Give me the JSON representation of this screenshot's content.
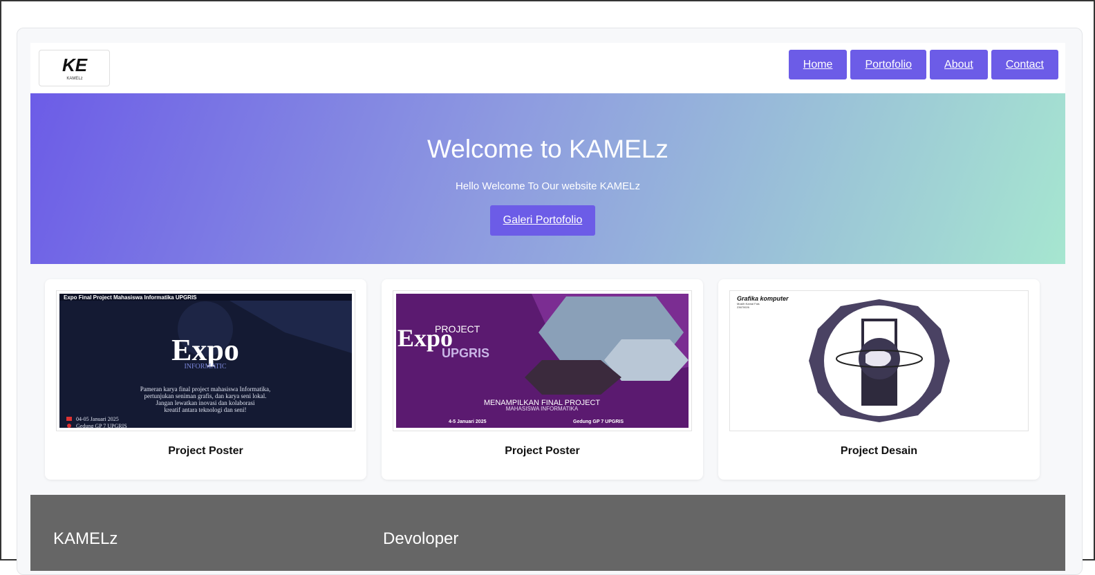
{
  "brand": {
    "logo_text": "KE",
    "logo_subtext": "KAMELz"
  },
  "nav": [
    {
      "label": "Home"
    },
    {
      "label": "Portofolio"
    },
    {
      "label": "About"
    },
    {
      "label": "Contact"
    }
  ],
  "hero": {
    "title": "Welcome to KAMELz",
    "subtitle": "Hello Welcome To Our website KAMELz",
    "button_label": "Galeri Portofolio"
  },
  "cards": [
    {
      "title": "Project Poster",
      "poster": {
        "header": "Expo Final Project Mahasiswa Informatika UPGRIS",
        "big": "Expo",
        "sub": "INFORMATIC",
        "desc1": "Pameran karya final project mahasiswa Informatika,",
        "desc2": "pertunjukan seniman grafis, dan karya seni lokal.",
        "desc3": "Jangan lewatkan inovasi dan kolaborasi",
        "desc4": "kreatif antara teknologi dan seni!",
        "date": "04-05 Januari 2025",
        "place": "Gedung GP 7 UPGRIS"
      }
    },
    {
      "title": "Project Poster",
      "poster": {
        "small": "PROJECT",
        "big": "Expo",
        "sub": "UPGRIS",
        "line1": "MENAMPILKAN FINAL PROJECT",
        "line2": "MAHASISWA INFORMATIKA",
        "date": "4-5 Januari 2025",
        "place": "Gedung GP 7 UPGRIS"
      }
    },
    {
      "title": "Project Desain",
      "poster": {
        "heading": "Grafika komputer",
        "name": "Muslih Kamal Fais",
        "id": "23670026"
      }
    }
  ],
  "footer": {
    "col1_title": "KAMELz",
    "col2_title": "Devoloper"
  },
  "colors": {
    "accent": "#6c5ce7",
    "footer_bg": "#666666"
  }
}
